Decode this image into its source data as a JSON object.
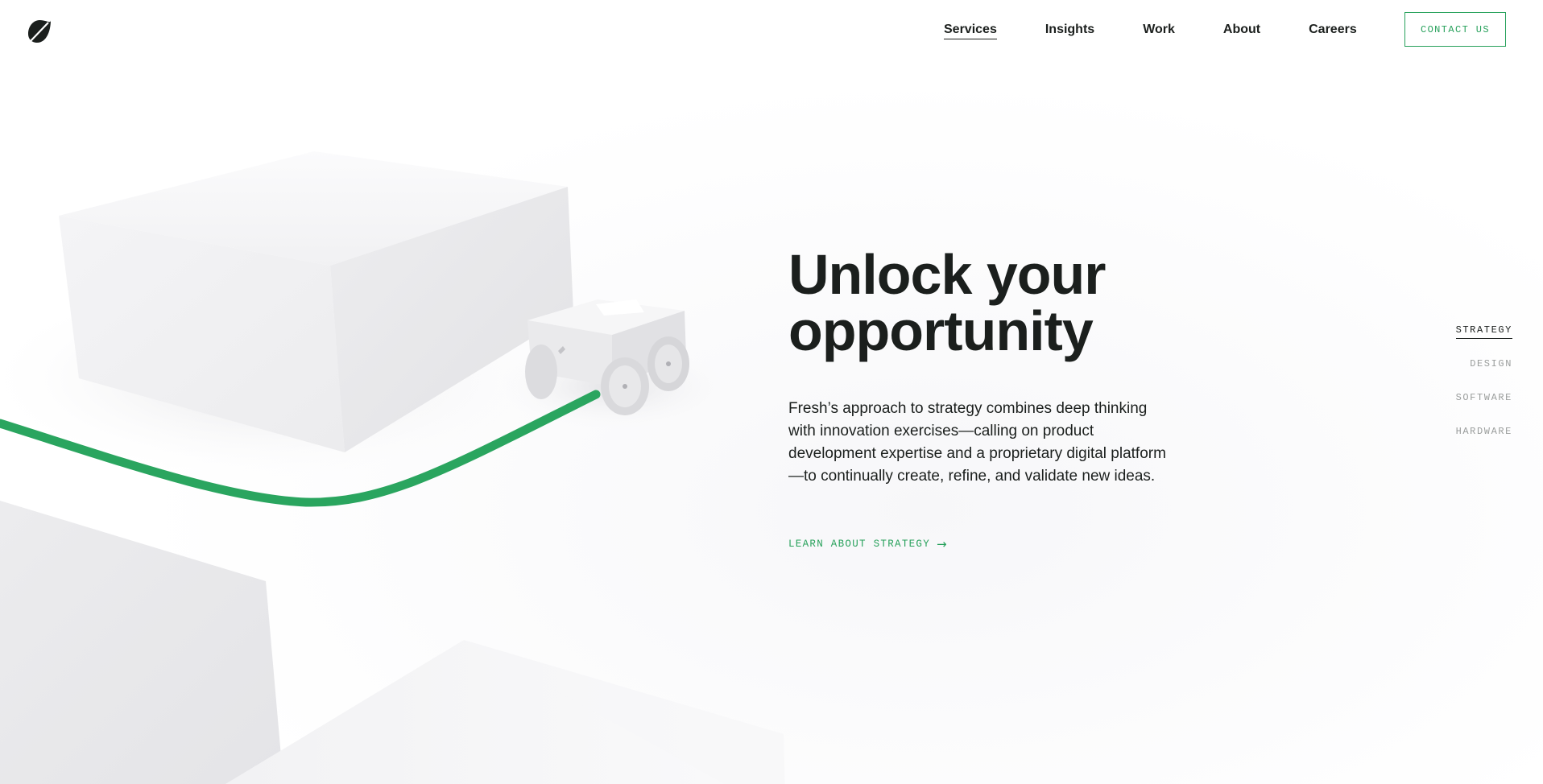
{
  "header": {
    "nav": [
      {
        "label": "Services",
        "active": true
      },
      {
        "label": "Insights",
        "active": false
      },
      {
        "label": "Work",
        "active": false
      },
      {
        "label": "About",
        "active": false
      },
      {
        "label": "Careers",
        "active": false
      }
    ],
    "contact_label": "CONTACT US",
    "logo_icon": "leaf-logo-icon"
  },
  "hero": {
    "title_line1": "Unlock your",
    "title_line2": "opportunity",
    "body": "Fresh’s approach to strategy combines deep thinking with innovation exercises—calling on product development expertise and a proprietary digital platform—to continually create, refine, and validate new ideas.",
    "link_label": "LEARN ABOUT STRATEGY",
    "link_icon": "arrow-right-icon"
  },
  "side_nav": {
    "items": [
      {
        "label": "STRATEGY",
        "active": true
      },
      {
        "label": "DESIGN",
        "active": false
      },
      {
        "label": "SOFTWARE",
        "active": false
      },
      {
        "label": "HARDWARE",
        "active": false
      }
    ]
  },
  "colors": {
    "accent_green": "#27a15b",
    "text_dark": "#1b1f1d",
    "muted_gray": "#9a9d9c"
  }
}
